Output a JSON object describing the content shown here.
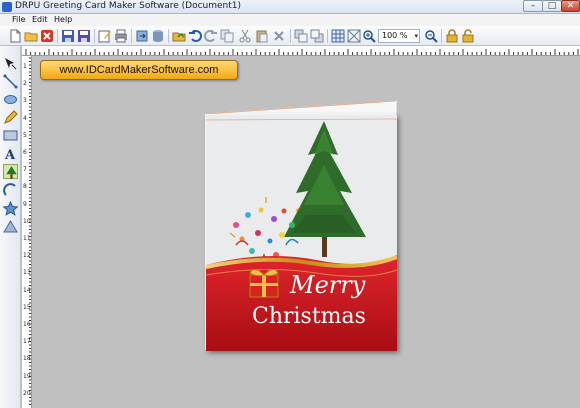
{
  "window": {
    "title": "DRPU Greeting Card Maker Software  (Document1)",
    "controls": {
      "minimize": "–",
      "maximize": "□",
      "close": "✕"
    }
  },
  "menu": [
    "File",
    "Edit",
    "Help"
  ],
  "toolbar": {
    "zoom_value": "100 %",
    "icons": [
      "new-document-icon",
      "open-folder-icon",
      "close-document-icon",
      "save-icon",
      "save-as-icon",
      "edit-icon",
      "print-icon",
      "export-icon",
      "database-icon",
      "open-file-icon",
      "undo-icon",
      "redo-icon",
      "copy-icon",
      "cut-icon",
      "paste-icon",
      "delete-icon",
      "bring-front-icon",
      "send-back-icon",
      "grid-icon",
      "snap-icon",
      "zoom-in-icon",
      "zoom-out-icon",
      "lock-icon",
      "unlock-icon"
    ]
  },
  "left_tools": [
    "pointer-tool-icon",
    "line-tool-icon",
    "ellipse-tool-icon",
    "pencil-tool-icon",
    "rectangle-tool-icon",
    "text-tool-icon",
    "image-tool-icon",
    "arc-tool-icon",
    "star-tool-icon",
    "triangle-tool-icon"
  ],
  "rulers": {
    "vertical_labels": [
      "1",
      "2",
      "3",
      "4",
      "5",
      "6",
      "7",
      "8",
      "9",
      "10",
      "11",
      "12",
      "13",
      "14",
      "15",
      "16",
      "17",
      "18",
      "19",
      "20"
    ]
  },
  "badge": {
    "text": "www.IDCardMakerSoftware.com"
  },
  "card": {
    "line1": "Merry",
    "line2": "Christmas",
    "colors": {
      "red": "#c8161d",
      "gold": "#d99a1c",
      "tree": "#2f6b2a",
      "background": "#e9ebec"
    }
  }
}
